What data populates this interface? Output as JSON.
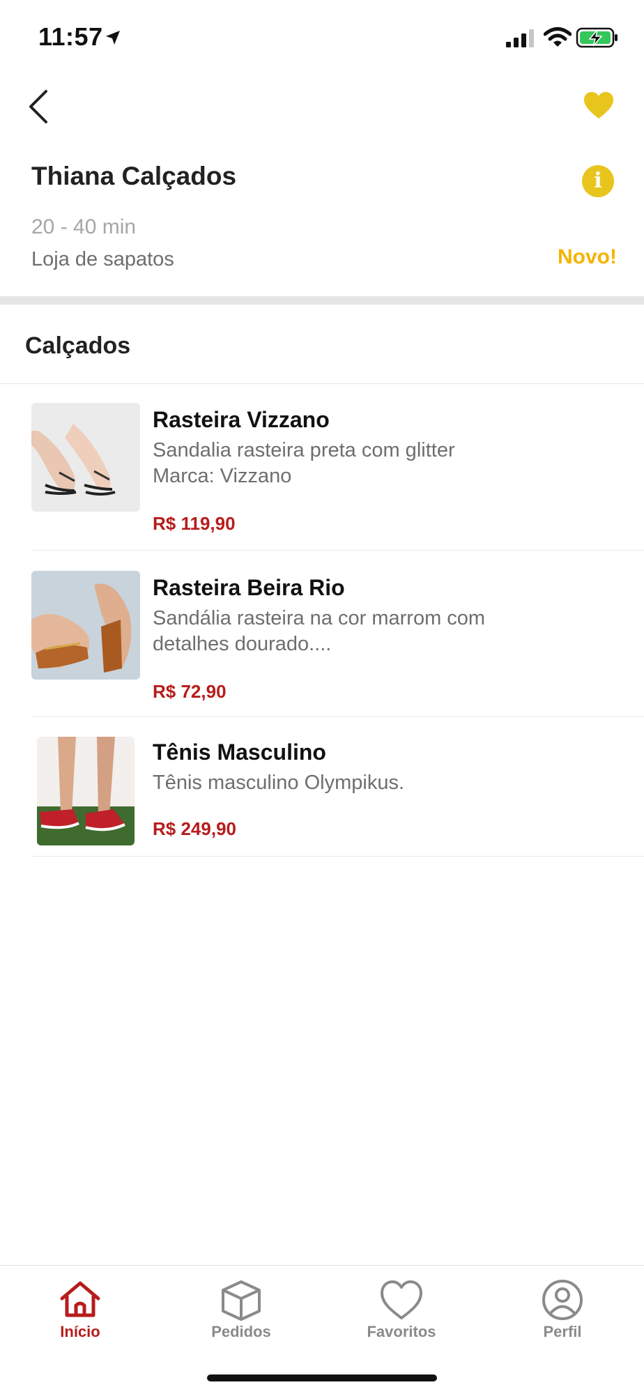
{
  "status_bar": {
    "time": "11:57"
  },
  "store": {
    "name": "Thiana Calçados",
    "delivery_time": "20 - 40 min",
    "category": "Loja de sapatos",
    "badge": "Novo!"
  },
  "section": {
    "title": "Calçados"
  },
  "products": [
    {
      "name": "Rasteira Vizzano",
      "desc_line1": "Sandalia rasteira preta com glitter",
      "desc_line2": "Marca: Vizzano",
      "price": "R$ 119,90"
    },
    {
      "name": "Rasteira Beira Rio",
      "desc_line1": "Sandália rasteira na cor marrom com",
      "desc_line2": "detalhes dourado....",
      "price": "R$ 72,90"
    },
    {
      "name": "Tênis Masculino",
      "desc_line1": "Tênis masculino Olympikus.",
      "desc_line2": "",
      "price": "R$ 249,90"
    }
  ],
  "tabs": [
    {
      "label": "Início",
      "icon": "home-icon",
      "active": true
    },
    {
      "label": "Pedidos",
      "icon": "box-icon",
      "active": false
    },
    {
      "label": "Favoritos",
      "icon": "heart-icon",
      "active": false
    },
    {
      "label": "Perfil",
      "icon": "user-icon",
      "active": false
    }
  ],
  "colors": {
    "accent_yellow": "#e8c51d",
    "badge_orange": "#f4b400",
    "price_red": "#b71c1c",
    "active_tab": "#b71c1c",
    "inactive_tab": "#8a8a8a"
  }
}
